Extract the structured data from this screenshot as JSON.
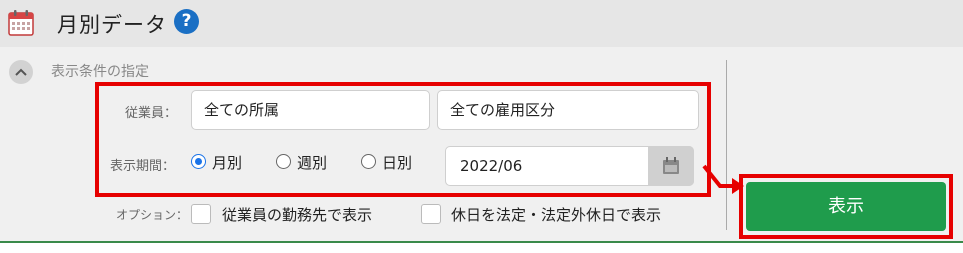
{
  "header": {
    "title": "月別データ",
    "help_glyph": "?"
  },
  "conditions": {
    "section_label": "表示条件の指定",
    "employee_label": "従業員：",
    "affiliation_value": "全ての所属",
    "employment_value": "全ての雇用区分",
    "period_label": "表示期間：",
    "period_options": [
      {
        "label": "月別",
        "selected": true
      },
      {
        "label": "週別",
        "selected": false
      },
      {
        "label": "日別",
        "selected": false
      }
    ],
    "date_value": "2022/06",
    "options_label": "オプション：",
    "options": [
      {
        "label": "従業員の勤務先で表示",
        "checked": false
      },
      {
        "label": "休日を法定・法定外休日で表示",
        "checked": false
      }
    ]
  },
  "actions": {
    "show_label": "表示"
  },
  "colors": {
    "accent_green": "#1f9c4c",
    "highlight_red": "#e60000",
    "radio_blue": "#1a73e8",
    "help_blue": "#1a6fc4"
  },
  "icons": [
    "calendar-icon",
    "help-icon",
    "chevron-up-icon",
    "calendar-picker-icon",
    "arrow-right-icon"
  ]
}
